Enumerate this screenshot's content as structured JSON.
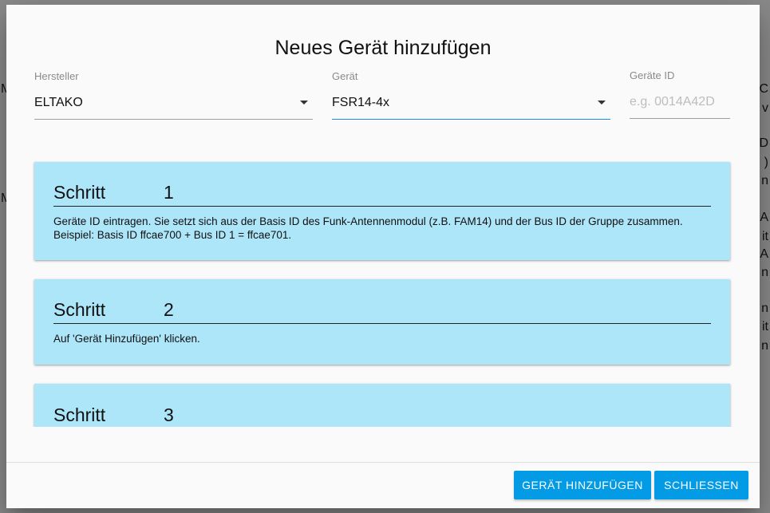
{
  "background": {
    "right_fragments": [
      "C",
      "v",
      "D",
      ")",
      "n",
      "A",
      "it",
      "A",
      "n",
      "n",
      "it",
      "n"
    ],
    "left_fragments": [
      "M",
      "M"
    ]
  },
  "dialog": {
    "title": "Neues Gerät hinzufügen",
    "fields": {
      "manufacturer": {
        "label": "Hersteller",
        "value": "ELTAKO"
      },
      "device": {
        "label": "Gerät",
        "value": "FSR14-4x"
      },
      "device_id": {
        "label": "Geräte ID",
        "placeholder": "e.g. 0014A42D"
      }
    },
    "steps": [
      {
        "word": "Schritt",
        "number": "1",
        "text": "Geräte ID eintragen. Sie setzt sich aus der Basis ID des Funk-Antennenmodul (z.B. FAM14) und der Bus ID der Gruppe zusammen. Beispiel: Basis ID ffcae700 + Bus ID 1 = ffcae701."
      },
      {
        "word": "Schritt",
        "number": "2",
        "text": "Auf 'Gerät Hinzufügen' klicken."
      },
      {
        "word": "Schritt",
        "number": "3",
        "text": ""
      }
    ],
    "buttons": {
      "add": "GERÄT HINZUFÜGEN",
      "close": "SCHLIESSEN"
    },
    "colors": {
      "card": "#ade5f9",
      "button": "#039be5",
      "focus": "#1e88e5"
    }
  }
}
